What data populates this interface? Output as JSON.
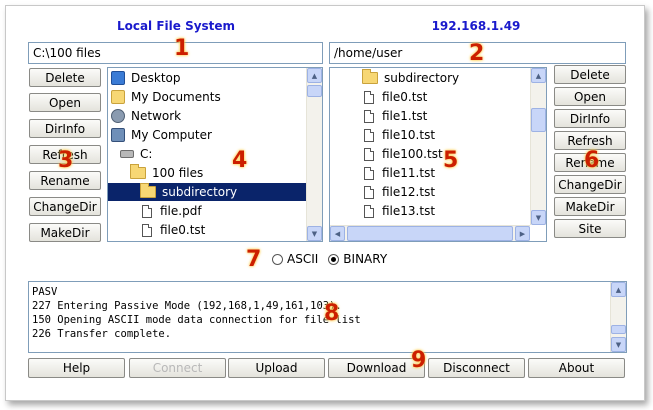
{
  "local": {
    "title": "Local File System",
    "path": "C:\\100 files",
    "buttons": [
      "Delete",
      "Open",
      "DirInfo",
      "Refresh",
      "Rename",
      "ChangeDir",
      "MakeDir"
    ],
    "tree": [
      {
        "label": "Desktop",
        "icon": "desktop-icon"
      },
      {
        "label": "My Documents",
        "icon": "my-documents-icon"
      },
      {
        "label": "Network",
        "icon": "network-icon"
      },
      {
        "label": "My Computer",
        "icon": "my-computer-icon"
      },
      {
        "label": "C:",
        "icon": "drive-icon"
      },
      {
        "label": "100 files",
        "icon": "folder-open-icon"
      },
      {
        "label": "subdirectory",
        "icon": "folder-icon",
        "selected": true
      },
      {
        "label": "file.pdf",
        "icon": "file-icon"
      },
      {
        "label": "file0.tst",
        "icon": "file-icon"
      }
    ]
  },
  "remote": {
    "title": "192.168.1.49",
    "path": "/home/user",
    "buttons": [
      "Delete",
      "Open",
      "DirInfo",
      "Refresh",
      "Rename",
      "ChangeDir",
      "MakeDir",
      "Site"
    ],
    "files": [
      {
        "label": "subdirectory",
        "icon": "folder-icon"
      },
      {
        "label": "file0.tst",
        "icon": "file-icon"
      },
      {
        "label": "file1.tst",
        "icon": "file-icon"
      },
      {
        "label": "file10.tst",
        "icon": "file-icon"
      },
      {
        "label": "file100.tst",
        "icon": "file-icon"
      },
      {
        "label": "file11.tst",
        "icon": "file-icon"
      },
      {
        "label": "file12.tst",
        "icon": "file-icon"
      },
      {
        "label": "file13.tst",
        "icon": "file-icon"
      }
    ]
  },
  "transfer_mode": {
    "options": [
      "ASCII",
      "BINARY"
    ],
    "selected": "BINARY"
  },
  "log": [
    "PASV",
    "227 Entering Passive Mode (192,168,1,49,161,103).",
    "150 Opening ASCII mode data connection for file list",
    "226 Transfer complete."
  ],
  "bottom_buttons": [
    {
      "label": "Help",
      "enabled": true
    },
    {
      "label": "Connect",
      "enabled": false
    },
    {
      "label": "Upload",
      "enabled": true
    },
    {
      "label": "Download",
      "enabled": true
    },
    {
      "label": "Disconnect",
      "enabled": true
    },
    {
      "label": "About",
      "enabled": true
    }
  ],
  "annotations": [
    "1",
    "2",
    "3",
    "4",
    "5",
    "6",
    "7",
    "8",
    "9"
  ],
  "colors": {
    "title": "#1a1acc",
    "annotation": "#cc1f00",
    "selection": "#0a246a",
    "scrollbar": "#c8d6f8"
  }
}
